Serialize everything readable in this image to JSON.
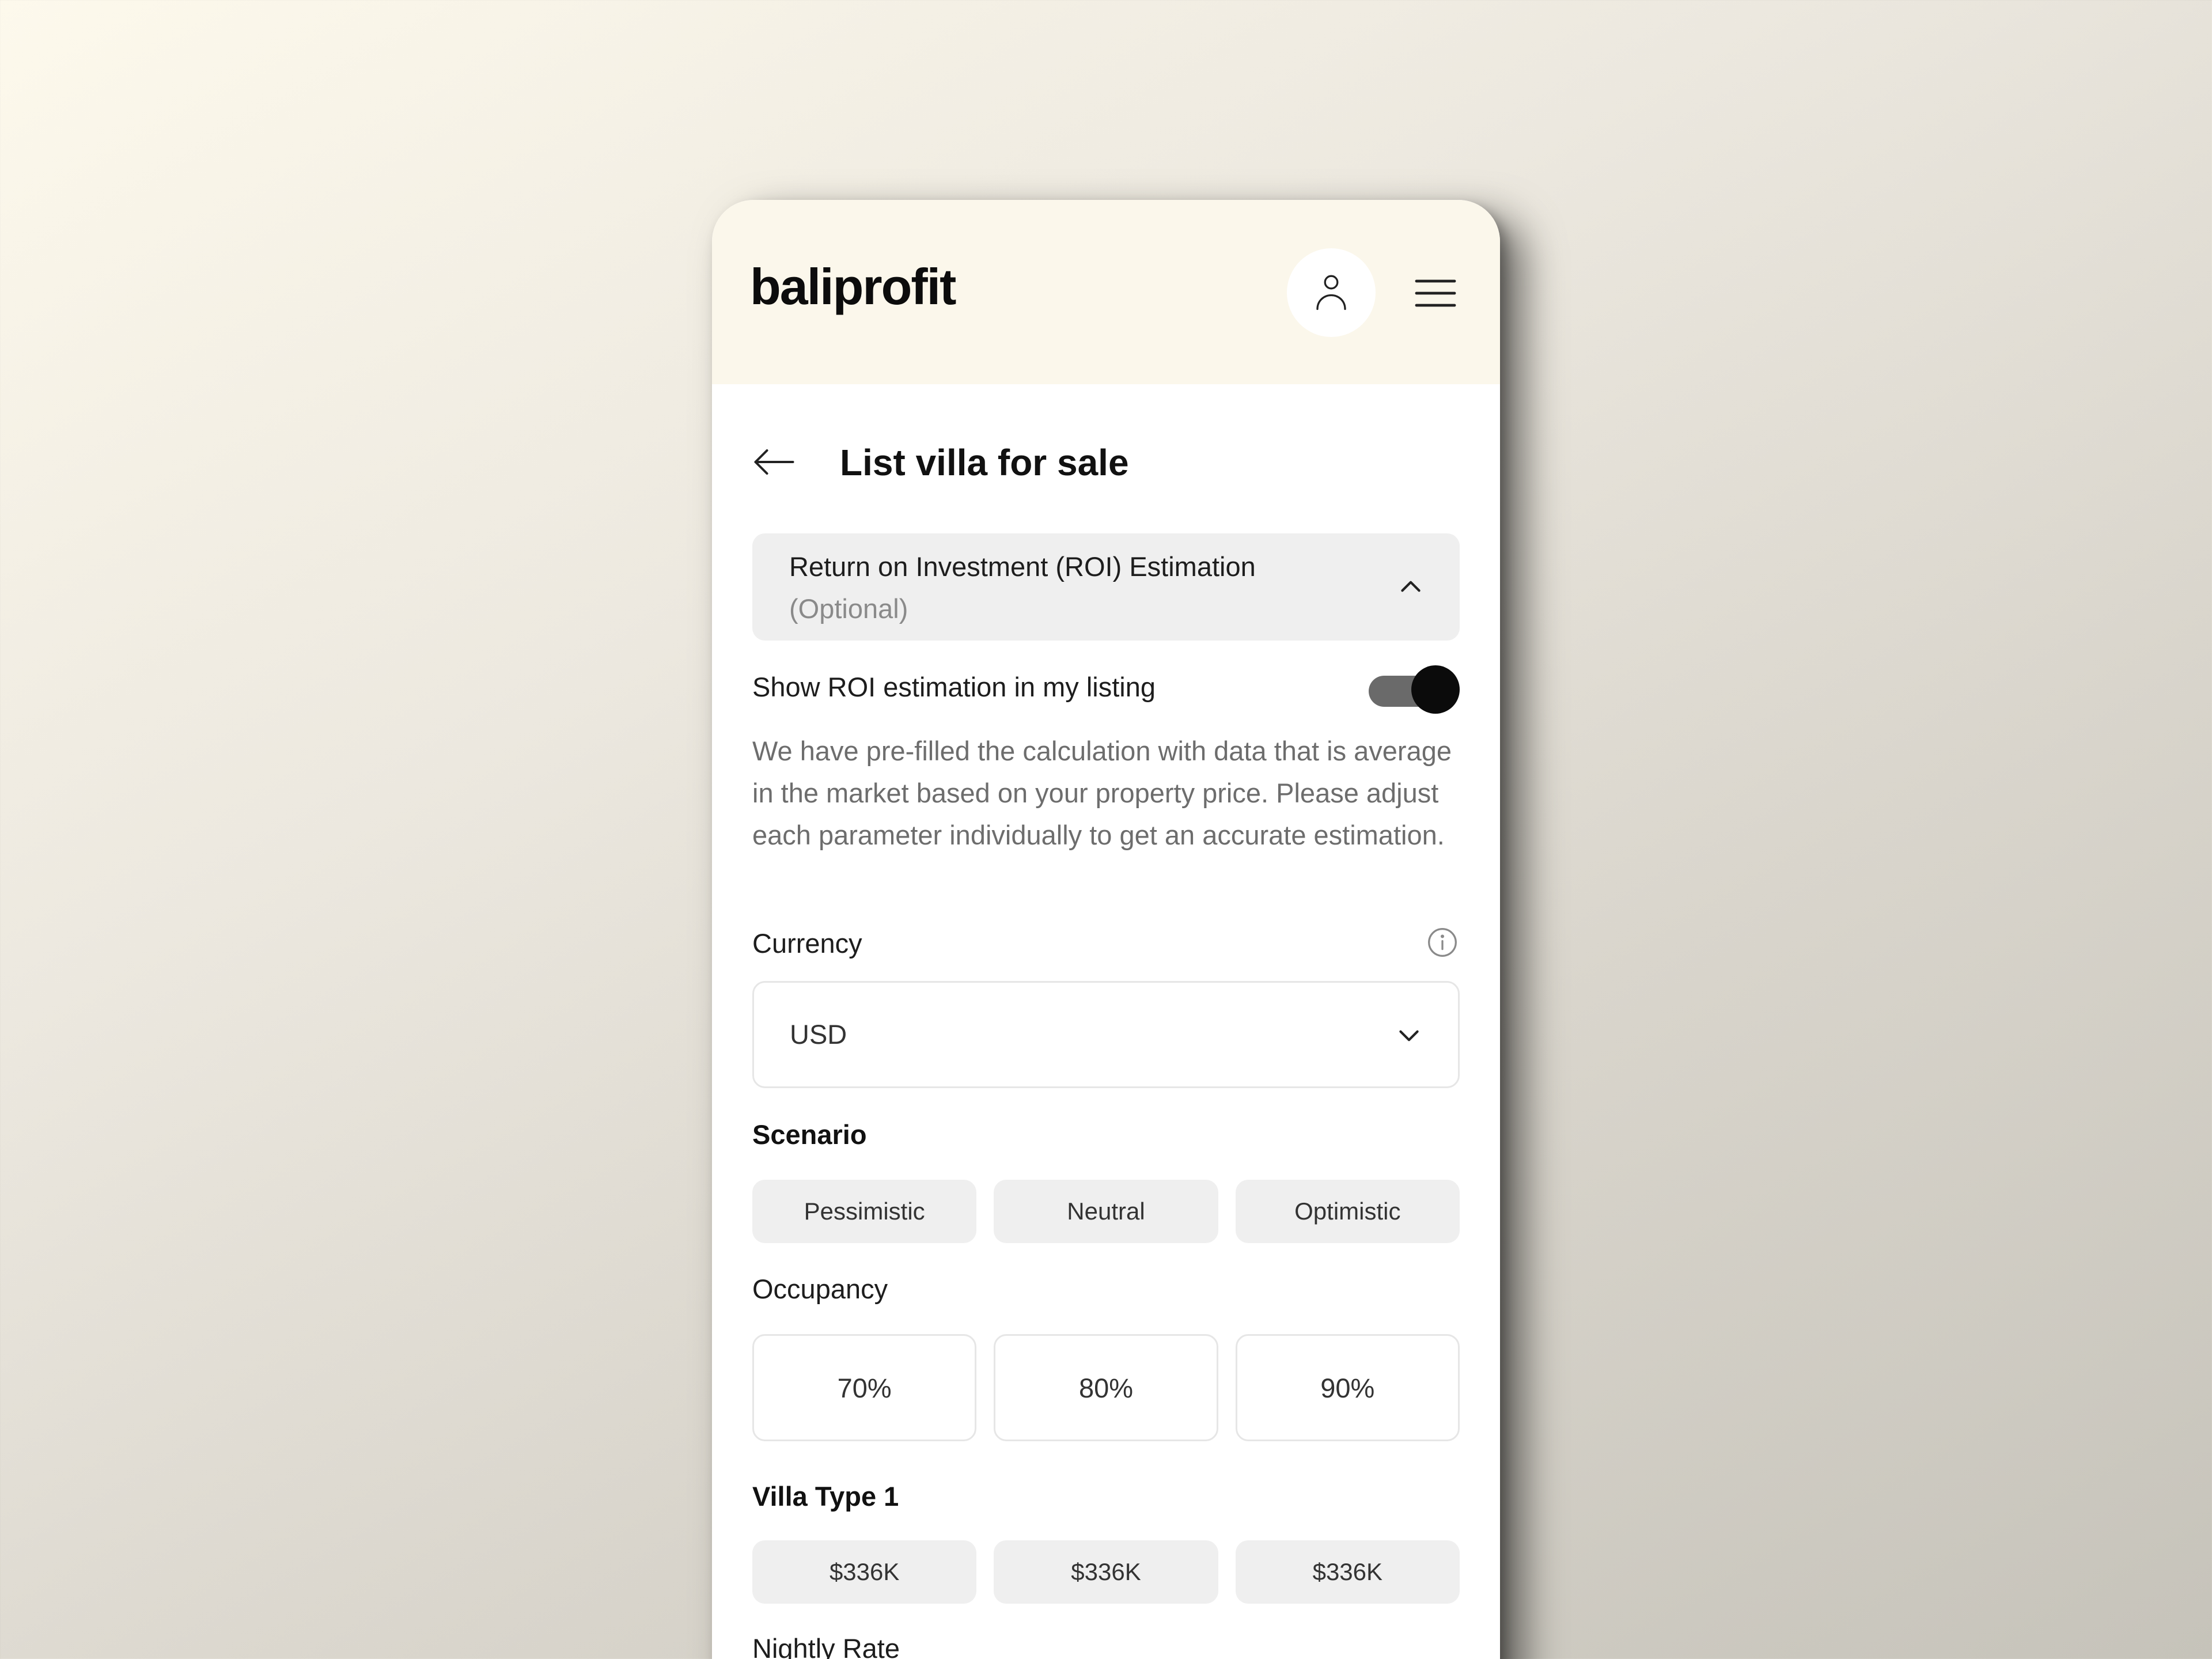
{
  "header": {
    "logo": "baliprofit",
    "profile_icon": "user-icon",
    "menu_icon": "hamburger-menu-icon"
  },
  "page": {
    "title": "List villa for sale",
    "back_icon": "arrow-left-icon"
  },
  "roi_section": {
    "title": "Return on Investment (ROI) Estimation",
    "subtitle": "(Optional)",
    "expanded": true,
    "chevron_icon": "chevron-up-icon"
  },
  "toggle": {
    "label": "Show ROI estimation in my listing",
    "on": true
  },
  "description": "We have pre-filled the calculation with data that is average in the market based on your property price. Please adjust each parameter individually to get an accurate estimation.",
  "currency": {
    "label": "Currency",
    "info_icon": "info-icon",
    "value": "USD",
    "chevron_icon": "chevron-down-icon"
  },
  "scenario": {
    "label": "Scenario",
    "options": [
      "Pessimistic",
      "Neutral",
      "Optimistic"
    ]
  },
  "occupancy": {
    "label": "Occupancy",
    "options": [
      "70%",
      "80%",
      "90%"
    ]
  },
  "villa_type": {
    "label": "Villa Type 1",
    "options": [
      "$336K",
      "$336K",
      "$336K"
    ]
  },
  "nightly_rate": {
    "label": "Nightly Rate"
  },
  "colors": {
    "header_bg": "#fbf7eb",
    "chip_bg": "#efefef",
    "toggle_knob": "#0b0b0b",
    "toggle_track": "#6a6a6a"
  }
}
